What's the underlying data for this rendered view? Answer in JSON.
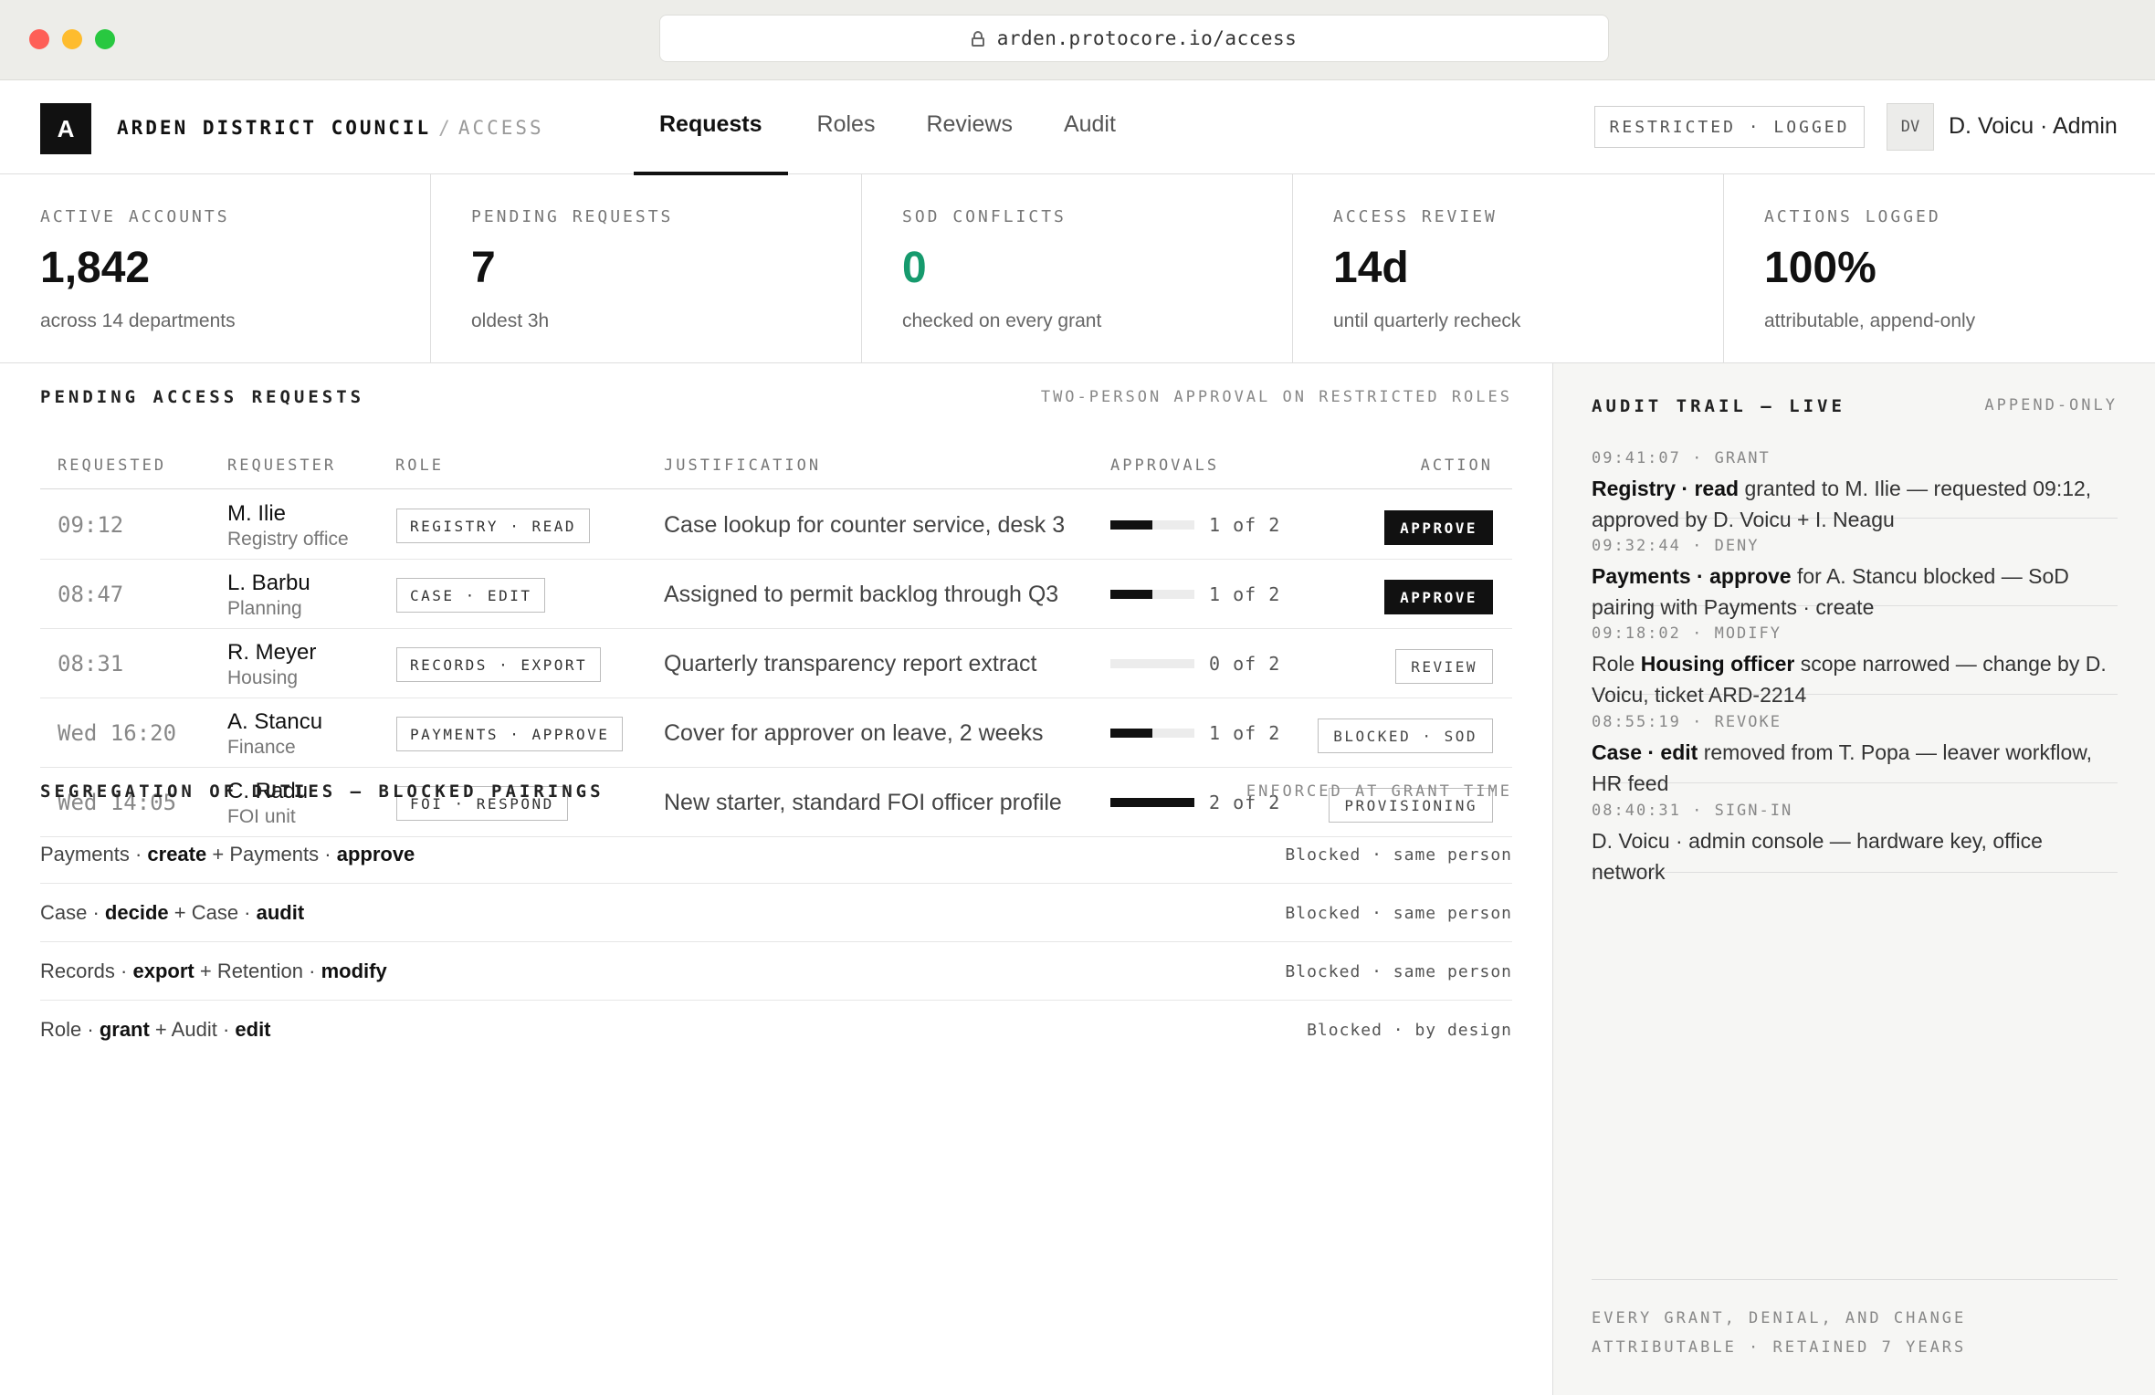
{
  "browser": {
    "url": "arden.protocore.io/access"
  },
  "header": {
    "logo_letter": "A",
    "org_name": "ARDEN DISTRICT COUNCIL",
    "crumb_sep": "/",
    "section": "ACCESS",
    "tabs": [
      {
        "label": "Requests",
        "active": true
      },
      {
        "label": "Roles",
        "active": false
      },
      {
        "label": "Reviews",
        "active": false
      },
      {
        "label": "Audit",
        "active": false
      }
    ],
    "mode_badge": "RESTRICTED · LOGGED",
    "avatar_initials": "DV",
    "user": "D. Voicu · Admin"
  },
  "stats": [
    {
      "label": "ACTIVE ACCOUNTS",
      "value": "1,842",
      "sub": "across 14 departments"
    },
    {
      "label": "PENDING REQUESTS",
      "value": "7",
      "sub": "oldest 3h"
    },
    {
      "label": "SOD CONFLICTS",
      "value": "0",
      "sub": "checked on every grant",
      "color": "#169a6d"
    },
    {
      "label": "ACCESS REVIEW",
      "value": "14d",
      "sub": "until quarterly recheck"
    },
    {
      "label": "ACTIONS LOGGED",
      "value": "100%",
      "sub": "attributable, append-only"
    }
  ],
  "requests": {
    "title": "PENDING ACCESS REQUESTS",
    "note": "TWO-PERSON APPROVAL ON RESTRICTED ROLES",
    "columns": [
      "REQUESTED",
      "REQUESTER",
      "ROLE",
      "JUSTIFICATION",
      "APPROVALS",
      "ACTION"
    ],
    "rows": [
      {
        "time": "09:12",
        "name": "M. Ilie",
        "dept": "Registry office",
        "role": "REGISTRY · READ",
        "justification": "Case lookup for counter service, desk 3",
        "approvals_done": 1,
        "approvals_needed": 2,
        "approvals_text": "1 of 2",
        "action": "APPROVE",
        "action_style": "primary"
      },
      {
        "time": "08:47",
        "name": "L. Barbu",
        "dept": "Planning",
        "role": "CASE · EDIT",
        "justification": "Assigned to permit backlog through Q3",
        "approvals_done": 1,
        "approvals_needed": 2,
        "approvals_text": "1 of 2",
        "action": "APPROVE",
        "action_style": "primary"
      },
      {
        "time": "08:31",
        "name": "R. Meyer",
        "dept": "Housing",
        "role": "RECORDS · EXPORT",
        "justification": "Quarterly transparency report extract",
        "approvals_done": 0,
        "approvals_needed": 2,
        "approvals_text": "0 of 2",
        "action": "REVIEW",
        "action_style": "outline"
      },
      {
        "time": "Wed 16:20",
        "name": "A. Stancu",
        "dept": "Finance",
        "role": "PAYMENTS · APPROVE",
        "justification": "Cover for approver on leave, 2 weeks",
        "approvals_done": 1,
        "approvals_needed": 2,
        "approvals_text": "1 of 2",
        "action": "BLOCKED · SOD",
        "action_style": "outline"
      },
      {
        "time": "Wed 14:05",
        "name": "C. Radu",
        "dept": "FOI unit",
        "role": "FOI · RESPOND",
        "justification": "New starter, standard FOI officer profile",
        "approvals_done": 2,
        "approvals_needed": 2,
        "approvals_text": "2 of 2",
        "action": "PROVISIONING",
        "action_style": "outline"
      }
    ]
  },
  "sod": {
    "title": "SEGREGATION OF DUTIES — BLOCKED PAIRINGS",
    "note": "ENFORCED AT GRANT TIME",
    "rows": [
      {
        "a_group": "Payments",
        "a_perm": "create",
        "b_group": "Payments",
        "b_perm": "approve",
        "status": "Blocked · same person"
      },
      {
        "a_group": "Case",
        "a_perm": "decide",
        "b_group": "Case",
        "b_perm": "audit",
        "status": "Blocked · same person"
      },
      {
        "a_group": "Records",
        "a_perm": "export",
        "b_group": "Retention",
        "b_perm": "modify",
        "status": "Blocked · same person"
      },
      {
        "a_group": "Role",
        "a_perm": "grant",
        "b_group": "Audit",
        "b_perm": "edit",
        "status": "Blocked · by design"
      }
    ]
  },
  "audit": {
    "title": "AUDIT TRAIL — LIVE",
    "note": "APPEND-ONLY",
    "entries": [
      {
        "meta": "09:41:07 · GRANT",
        "parts": [
          [
            "b",
            "Registry · read"
          ],
          [
            "t",
            " granted to M. Ilie — requested 09:12, approved by D. Voicu + I. Neagu"
          ]
        ]
      },
      {
        "meta": "09:32:44 · DENY",
        "parts": [
          [
            "b",
            "Payments · approve"
          ],
          [
            "t",
            " for A. Stancu blocked — SoD pairing with Payments · create"
          ]
        ]
      },
      {
        "meta": "09:18:02 · MODIFY",
        "parts": [
          [
            "t",
            "Role "
          ],
          [
            "b",
            "Housing officer"
          ],
          [
            "t",
            " scope narrowed — change by D. Voicu, ticket ARD-2214"
          ]
        ]
      },
      {
        "meta": "08:55:19 · REVOKE",
        "parts": [
          [
            "b",
            "Case · edit"
          ],
          [
            "t",
            " removed from T. Popa — leaver workflow, HR feed"
          ]
        ]
      },
      {
        "meta": "08:40:31 · SIGN-IN",
        "parts": [
          [
            "t",
            "D. Voicu · admin console — hardware key, office network"
          ]
        ]
      }
    ],
    "footer_line1": "EVERY GRANT, DENIAL, AND CHANGE",
    "footer_line2": "ATTRIBUTABLE · RETAINED 7 YEARS"
  }
}
